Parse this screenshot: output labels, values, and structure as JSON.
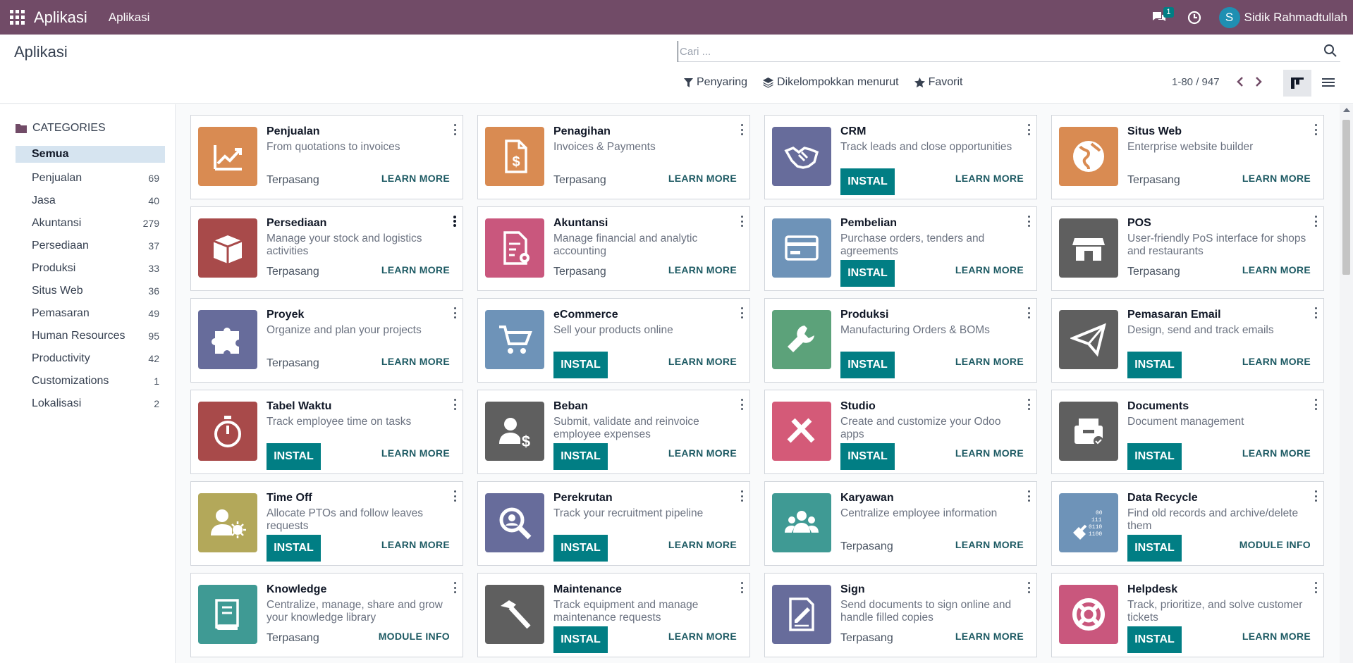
{
  "navbar": {
    "brand": "Aplikasi",
    "menu": "Aplikasi",
    "chat_badge": "1",
    "user_initial": "S",
    "user_name": "Sidik Rahmadtullah"
  },
  "control": {
    "title": "Aplikasi",
    "search_placeholder": "Cari ...",
    "filters": [
      "Penyaring",
      "Dikelompokkan menurut",
      "Favorit"
    ],
    "pager": "1-80 / 947"
  },
  "sidebar": {
    "header": "CATEGORIES",
    "items": [
      {
        "label": "Semua",
        "count": ""
      },
      {
        "label": "Penjualan",
        "count": "69"
      },
      {
        "label": "Jasa",
        "count": "40"
      },
      {
        "label": "Akuntansi",
        "count": "279"
      },
      {
        "label": "Persediaan",
        "count": "37"
      },
      {
        "label": "Produksi",
        "count": "33"
      },
      {
        "label": "Situs Web",
        "count": "36"
      },
      {
        "label": "Pemasaran",
        "count": "49"
      },
      {
        "label": "Human Resources",
        "count": "95"
      },
      {
        "label": "Productivity",
        "count": "42"
      },
      {
        "label": "Customizations",
        "count": "1"
      },
      {
        "label": "Lokalisasi",
        "count": "2"
      }
    ]
  },
  "labels": {
    "installed": "Terpasang",
    "install": "INSTAL",
    "learn_more": "LEARN MORE",
    "module_info": "MODULE INFO"
  },
  "apps": [
    {
      "name": "Penjualan",
      "desc": "From quotations to invoices",
      "state": "installed",
      "link": "LEARN MORE",
      "color": "#d98b52",
      "icon": "chart-trend-icon"
    },
    {
      "name": "Penagihan",
      "desc": "Invoices & Payments",
      "state": "installed",
      "link": "LEARN MORE",
      "color": "#d98b52",
      "icon": "invoice-icon"
    },
    {
      "name": "CRM",
      "desc": "Track leads and close opportunities",
      "state": "install",
      "link": "LEARN MORE",
      "color": "#676c9b",
      "icon": "handshake-icon"
    },
    {
      "name": "Situs Web",
      "desc": "Enterprise website builder",
      "state": "installed",
      "link": "LEARN MORE",
      "color": "#d98b52",
      "icon": "globe-icon"
    },
    {
      "name": "Persediaan",
      "desc": "Manage your stock and logistics activities",
      "state": "installed",
      "link": "LEARN MORE",
      "color": "#a84a4a",
      "icon": "box-icon"
    },
    {
      "name": "Akuntansi",
      "desc": "Manage financial and analytic accounting",
      "state": "installed",
      "link": "LEARN MORE",
      "color": "#c9577d",
      "icon": "document-gear-icon"
    },
    {
      "name": "Pembelian",
      "desc": "Purchase orders, tenders and agreements",
      "state": "install",
      "link": "LEARN MORE",
      "color": "#6e93b8",
      "icon": "credit-card-icon"
    },
    {
      "name": "POS",
      "desc": "User-friendly PoS interface for shops and restaurants",
      "state": "installed",
      "link": "LEARN MORE",
      "color": "#5f5f5f",
      "icon": "shop-icon"
    },
    {
      "name": "Proyek",
      "desc": "Organize and plan your projects",
      "state": "installed",
      "link": "LEARN MORE",
      "color": "#676c9b",
      "icon": "puzzle-icon"
    },
    {
      "name": "eCommerce",
      "desc": "Sell your products online",
      "state": "install",
      "link": "LEARN MORE",
      "color": "#6e93b8",
      "icon": "cart-icon"
    },
    {
      "name": "Produksi",
      "desc": "Manufacturing Orders & BOMs",
      "state": "install",
      "link": "LEARN MORE",
      "color": "#5ca27a",
      "icon": "wrench-icon"
    },
    {
      "name": "Pemasaran Email",
      "desc": "Design, send and track emails",
      "state": "install",
      "link": "LEARN MORE",
      "color": "#5f5f5f",
      "icon": "paper-plane-icon"
    },
    {
      "name": "Tabel Waktu",
      "desc": "Track employee time on tasks",
      "state": "install",
      "link": "LEARN MORE",
      "color": "#a84a4a",
      "icon": "stopwatch-icon"
    },
    {
      "name": "Beban",
      "desc": "Submit, validate and reinvoice employee expenses",
      "state": "install",
      "link": "LEARN MORE",
      "color": "#5f5f5f",
      "icon": "user-dollar-icon"
    },
    {
      "name": "Studio",
      "desc": "Create and customize your Odoo apps",
      "state": "install",
      "link": "LEARN MORE",
      "color": "#d45a78",
      "icon": "tools-icon"
    },
    {
      "name": "Documents",
      "desc": "Document management",
      "state": "install",
      "link": "LEARN MORE",
      "color": "#5f5f5f",
      "icon": "inbox-check-icon"
    },
    {
      "name": "Time Off",
      "desc": "Allocate PTOs and follow leaves requests",
      "state": "install",
      "link": "LEARN MORE",
      "color": "#b3a85a",
      "icon": "user-sun-icon"
    },
    {
      "name": "Perekrutan",
      "desc": "Track your recruitment pipeline",
      "state": "install",
      "link": "LEARN MORE",
      "color": "#676c9b",
      "icon": "magnifier-icon"
    },
    {
      "name": "Karyawan",
      "desc": "Centralize employee information",
      "state": "installed",
      "link": "LEARN MORE",
      "color": "#3f9a94",
      "icon": "users-icon"
    },
    {
      "name": "Data Recycle",
      "desc": "Find old records and archive/delete them",
      "state": "install",
      "link": "MODULE INFO",
      "color": "#6e93b8",
      "icon": "broom-binary-icon"
    },
    {
      "name": "Knowledge",
      "desc": "Centralize, manage, share and grow your knowledge library",
      "state": "installed",
      "link": "MODULE INFO",
      "color": "#3f9a94",
      "icon": "book-icon"
    },
    {
      "name": "Maintenance",
      "desc": "Track equipment and manage maintenance requests",
      "state": "install",
      "link": "LEARN MORE",
      "color": "#5f5f5f",
      "icon": "hammer-icon"
    },
    {
      "name": "Sign",
      "desc": "Send documents to sign online and handle filled copies",
      "state": "installed",
      "link": "LEARN MORE",
      "color": "#676c9b",
      "icon": "signature-doc-icon"
    },
    {
      "name": "Helpdesk",
      "desc": "Track, prioritize, and solve customer tickets",
      "state": "install",
      "link": "LEARN MORE",
      "color": "#c9577d",
      "icon": "lifebuoy-icon"
    }
  ]
}
